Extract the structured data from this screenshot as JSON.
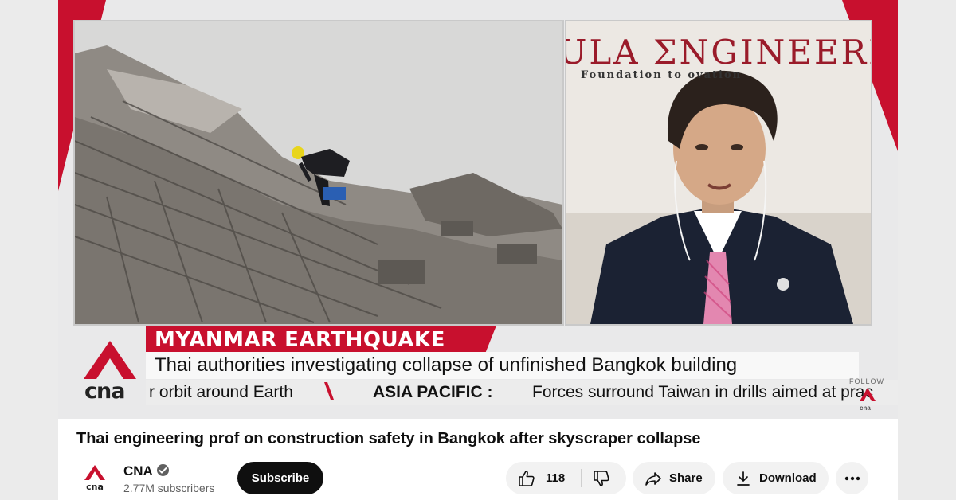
{
  "video": {
    "headline": "MYANMAR EARTHQUAKE",
    "subheadline": "Thai authorities investigating collapse of unfinished Bangkok building",
    "ticker_left": "r orbit around Earth",
    "ticker_category": "ASIA PACIFIC :",
    "ticker_right": "Forces surround Taiwan in drills aimed at prac",
    "logo_text": "cna",
    "follow_label": "FOLLOW",
    "follow_logo_text": "cna",
    "backdrop_sign_title": "ULA ƩNGINEERIN",
    "backdrop_sign_subtitle": "Foundation to     ovation"
  },
  "video_title": "Thai engineering prof on construction safety in Bangkok after skyscraper collapse",
  "channel": {
    "logo_text": "cna",
    "name": "CNA",
    "subscribers": "2.77M subscribers",
    "verified_icon": "verified-check-icon"
  },
  "actions": {
    "subscribe_label": "Subscribe",
    "like_count": "118",
    "share_label": "Share",
    "download_label": "Download"
  },
  "colors": {
    "cna_red": "#c8102e",
    "button_dark": "#0f0f0f",
    "pill_bg": "#f2f2f2"
  }
}
